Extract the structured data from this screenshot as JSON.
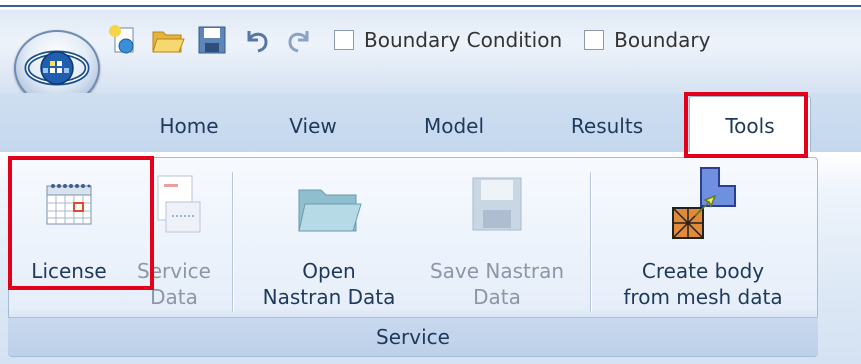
{
  "qat": {
    "checkboxes": [
      {
        "label": "Boundary Condition",
        "checked": false
      },
      {
        "label": "Boundary",
        "checked": false
      }
    ],
    "icons": [
      "new-file-icon",
      "open-folder-icon",
      "save-icon",
      "undo-icon",
      "redo-icon"
    ]
  },
  "tabs": [
    "Home",
    "View",
    "Model",
    "Results",
    "Tools"
  ],
  "active_tab": "Tools",
  "group": {
    "label": "Service"
  },
  "buttons": [
    {
      "id": "license",
      "line1": "License",
      "line2": "",
      "enabled": true
    },
    {
      "id": "service-data",
      "line1": "Service",
      "line2": "Data",
      "enabled": false
    },
    {
      "id": "open-nastran",
      "line1": "Open",
      "line2": "Nastran Data",
      "enabled": true
    },
    {
      "id": "save-nastran",
      "line1": "Save Nastran",
      "line2": "Data",
      "enabled": false
    },
    {
      "id": "create-body",
      "line1": "Create body",
      "line2": "from mesh data",
      "enabled": true
    }
  ],
  "colors": {
    "highlight": "#e2001a",
    "tab_text": "#1e395b",
    "disabled_text": "#8b97a6"
  }
}
